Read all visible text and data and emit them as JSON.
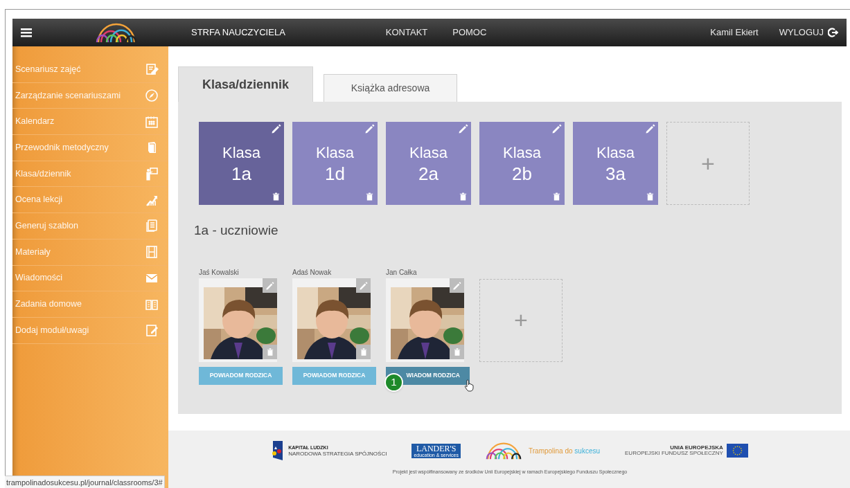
{
  "header": {
    "title": "STRFA NAUCZYCIELA",
    "nav": [
      "KONTAKT",
      "POMOC"
    ],
    "user": "Kamil Ekiert",
    "logout": "WYLOGUJ"
  },
  "sidebar": {
    "items": [
      {
        "label": "Scenariusz zajęć"
      },
      {
        "label": "Zarządzanie scenariuszami"
      },
      {
        "label": "Kalendarz"
      },
      {
        "label": "Przewodnik metodyczny"
      },
      {
        "label": "Klasa/dziennik"
      },
      {
        "label": "Ocena lekcji"
      },
      {
        "label": "Generuj szablon"
      },
      {
        "label": "Materiały"
      },
      {
        "label": "Wiadomości"
      },
      {
        "label": "Zadania domowe"
      },
      {
        "label": "Dodaj moduł/uwagi"
      }
    ]
  },
  "tabs": [
    {
      "label": "Klasa/dziennik",
      "selected": true
    },
    {
      "label": "Książka adresowa",
      "selected": false
    }
  ],
  "classes": [
    {
      "label": "Klasa",
      "name": "1a",
      "selected": true
    },
    {
      "label": "Klasa",
      "name": "1d",
      "selected": false
    },
    {
      "label": "Klasa",
      "name": "2a",
      "selected": false
    },
    {
      "label": "Klasa",
      "name": "2b",
      "selected": false
    },
    {
      "label": "Klasa",
      "name": "3a",
      "selected": false
    }
  ],
  "add_class": "+",
  "section_title": "1a - uczniowie",
  "students": [
    {
      "name": "Jaś Kowalski",
      "button": "POWIADOM RODZICA",
      "hovered": false
    },
    {
      "name": "Adaś Nowak",
      "button": "POWIADOM RODZICA",
      "hovered": false
    },
    {
      "name": "Jan Całka",
      "button": "WIADOM RODZICA",
      "hovered": true
    }
  ],
  "add_student": "+",
  "callout": "1",
  "footer": {
    "kapital": "KAPITAŁ LUDZKI",
    "kapital_sub": "NARODOWA STRATEGIA SPÓJNOŚCI",
    "landers": "LANDER'S",
    "landers_sub": "education & services",
    "brand_a": "Trampolina do",
    "brand_b": "sukcesu",
    "eu": "UNIA EUROPEJSKA",
    "eu_sub": "EUROPEJSKI FUNDUSZ SPOŁECZNY",
    "note": "Projekt jest współfinansowany ze środków Unii Europejskiej w ramach Europejskiego Funduszu Społecznego"
  },
  "status_url": "trampolinadosukcesu.pl/journal/classrooms/3#"
}
